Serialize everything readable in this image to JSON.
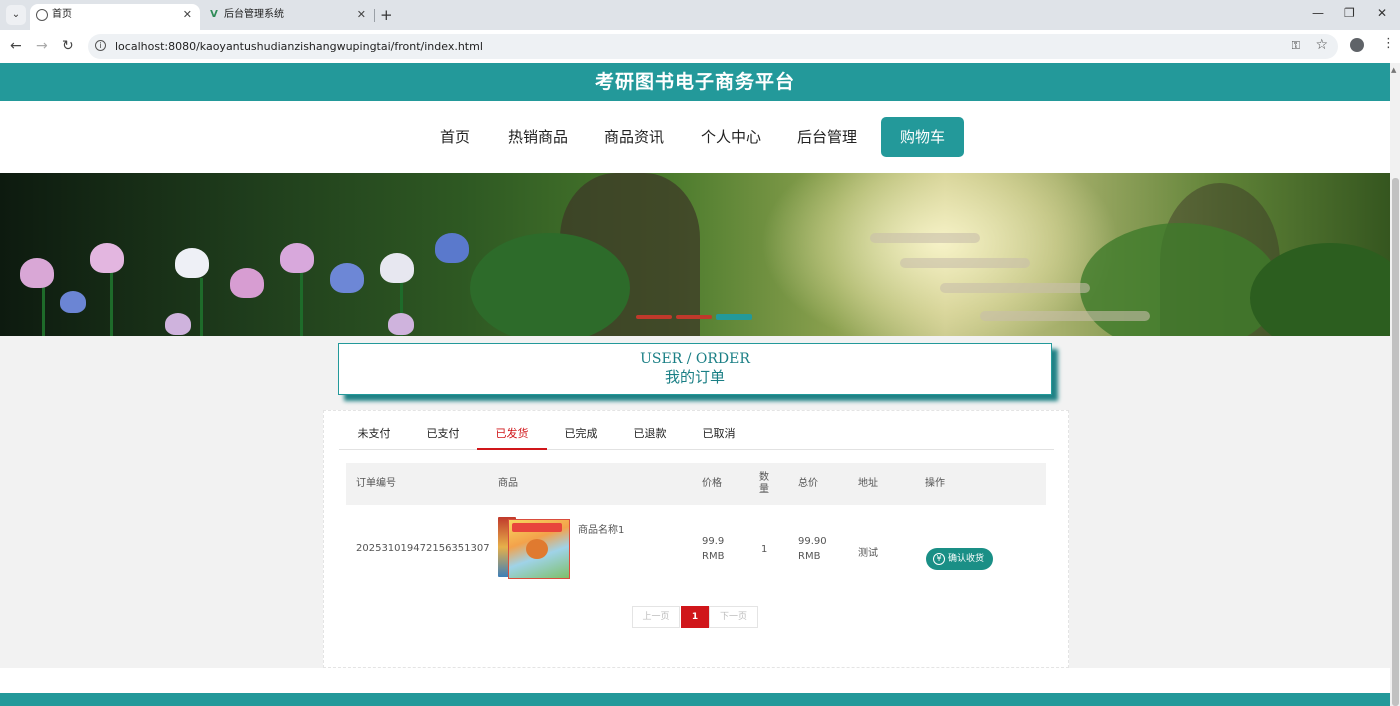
{
  "browser": {
    "tabs": [
      {
        "title": "首页",
        "icon": "globe-icon",
        "active": true
      },
      {
        "title": "后台管理系统",
        "icon": "vue-logo-icon",
        "active": false
      }
    ],
    "url": "localhost:8080/kaoyantushudianzishangwupingtai/front/index.html",
    "new_tab": "+",
    "close": "✕",
    "minimize": "—",
    "restore": "❐",
    "window_close": "✕",
    "back": "←",
    "forward": "→",
    "reload": "↻",
    "tab_menu": "⌄",
    "info": "i",
    "key": "⚿",
    "star": "☆",
    "menu": "⋮"
  },
  "site": {
    "title": "考研图书电子商务平台",
    "accent": "#23999a",
    "nav": [
      {
        "label": "首页"
      },
      {
        "label": "热销商品"
      },
      {
        "label": "商品资讯"
      },
      {
        "label": "个人中心"
      },
      {
        "label": "后台管理"
      },
      {
        "label": "购物车",
        "active": true
      }
    ]
  },
  "banner": {
    "slide_count": 3,
    "active_slide": 3
  },
  "section": {
    "title_en": "USER / ORDER",
    "title_cn": "我的订单"
  },
  "order_tabs": [
    {
      "label": "未支付"
    },
    {
      "label": "已支付"
    },
    {
      "label": "已发货",
      "active": true
    },
    {
      "label": "已完成"
    },
    {
      "label": "已退款"
    },
    {
      "label": "已取消"
    }
  ],
  "table": {
    "headers": {
      "order_no": "订单编号",
      "product": "商品",
      "price": "价格",
      "qty": "数量",
      "total": "总价",
      "address": "地址",
      "action": "操作"
    },
    "rows": [
      {
        "order_no": "20253101947215635130​7",
        "product_name": "商品名称1",
        "price": "99.9",
        "price_unit": "RMB",
        "qty": "1",
        "total": "99.90",
        "total_unit": "RMB",
        "address": "测试",
        "action": "确认收货",
        "action_icon": "yen-icon"
      }
    ]
  },
  "pagination": {
    "prev": "上一页",
    "current": "1",
    "next": "下一页"
  }
}
